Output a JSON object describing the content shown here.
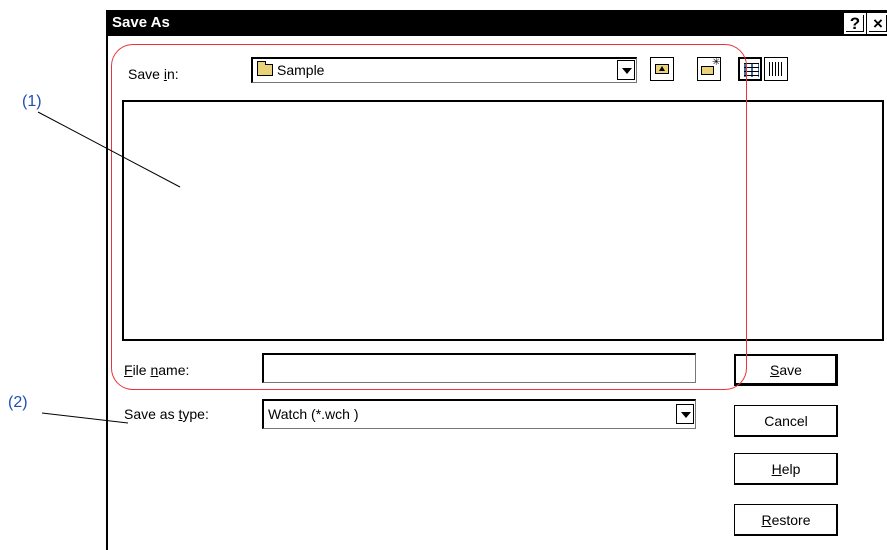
{
  "window": {
    "title": "Save As",
    "help_label": "?",
    "close_label": "×"
  },
  "save_in": {
    "label_pre": "Save ",
    "label_underlined": "i",
    "label_post": "n:",
    "value": "Sample"
  },
  "file_name": {
    "label_pre": "",
    "label_underlined": "F",
    "label_mid": "ile ",
    "label_underlined2": "n",
    "label_post": "ame:",
    "value": ""
  },
  "save_as_type": {
    "label_pre": "Save as ",
    "label_underlined": "t",
    "label_post": "ype:",
    "value": "Watch (*.wch )"
  },
  "buttons": {
    "save": {
      "underlined": "S",
      "rest": "ave"
    },
    "cancel": {
      "label": "Cancel"
    },
    "help": {
      "underlined": "H",
      "rest": "elp"
    },
    "restore": {
      "underlined": "R",
      "rest": "estore"
    }
  },
  "annotations": {
    "callout_1": "(1)",
    "callout_2": "(2)"
  },
  "colors": {
    "highlight": "#e8343a",
    "callout": "#1f4fb5"
  }
}
